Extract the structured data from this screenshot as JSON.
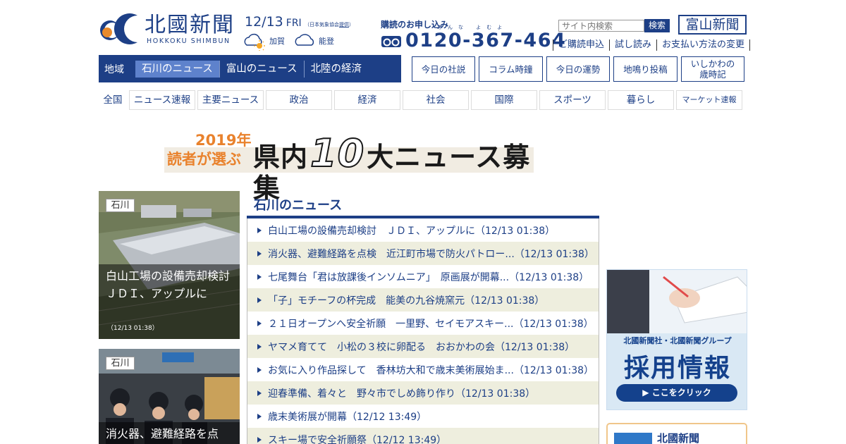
{
  "header": {
    "logo_text": "北國新聞",
    "logo_sub": "HOKKOKU SHIMBUN",
    "date": "12/13",
    "weekday": "FRI",
    "weather_source": "（日本気象協会",
    "weather_source_link": "提供",
    "weather_source_end": "）",
    "weather": [
      {
        "icon": "sunny-cloudy-icon",
        "label": "加賀"
      },
      {
        "icon": "cloudy-icon",
        "label": "能登"
      }
    ],
    "subscribe_label": "購読のお申し込み",
    "phone_ruby": "みんな よむよ",
    "phone_number": "0120-367-464",
    "search_placeholder": "サイト内検索",
    "search_button": "検索",
    "toyama_button": "富山新聞",
    "sub_links": [
      "ご購読申込",
      "試し読み",
      "お支払い方法の変更"
    ]
  },
  "region_nav": {
    "label": "地域",
    "tabs": [
      "石川のニュース",
      "富山のニュース",
      "北陸の経済"
    ]
  },
  "column_buttons": [
    "今日の社説",
    "コラム時鐘",
    "今日の運勢",
    "地鳴り投稿",
    "いしかわの\n歳時記"
  ],
  "category_nav": {
    "label": "全国",
    "items": [
      "ニュース速報",
      "主要ニュース",
      "政治",
      "経済",
      "社会",
      "国際",
      "スポーツ",
      "暮らし",
      "マーケット速報"
    ]
  },
  "banner": {
    "year": "2019年",
    "sub": "読者が選ぶ",
    "main_prefix": "県内",
    "main_number": "10",
    "main_suffix": "大ニュース募集"
  },
  "photo_cards": [
    {
      "tag": "石川",
      "caption": "白山工場の設備売却検討　ＪＤＩ、アップルに",
      "time": "（12/13 01:38）"
    },
    {
      "tag": "石川",
      "caption": "消火器、避難経路を点"
    }
  ],
  "news": {
    "title": "石川のニュース",
    "items": [
      "白山工場の設備売却検討　ＪＤＩ、アップルに（12/13 01:38）",
      "消火器、避難経路を点検　近江町市場で防火パトロー...（12/13 01:38）",
      "七尾舞台「君は放課後インソムニア」　原画展が開幕...（12/13 01:38）",
      "「子」モチーフの杯完成　能美の九谷焼窯元（12/13 01:38）",
      "２１日オープンへ安全祈願　一里野、セイモアスキー...（12/13 01:38）",
      "ヤマメ育てて　小松の３校に卵配る　おおかわの会（12/13 01:38）",
      "お気に入り作品探して　香林坊大和で歳末美術展始ま...（12/13 01:38）",
      "迎春準備、着々と　野々市でしめ飾り作り（12/13 01:38）",
      "歳末美術展が開幕（12/12 13:49）",
      "スキー場で安全祈願祭（12/12 13:49）"
    ]
  },
  "ads": {
    "recruit_caption": "北國新聞社・北國新聞グループ",
    "recruit_title": "採用情報",
    "recruit_button": "▶ ここをクリック",
    "second_text": "北國新聞"
  },
  "colors": {
    "brand": "#1d3f86",
    "active_tab": "#5e82cc",
    "stripe": "#eeeede",
    "banner_accent": "#e9822d"
  }
}
